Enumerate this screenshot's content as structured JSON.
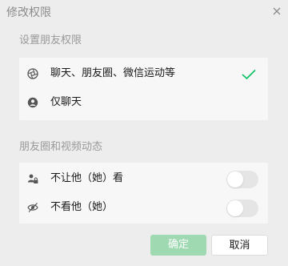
{
  "dialog": {
    "title": "修改权限",
    "close_icon": "close-icon"
  },
  "friend_permission": {
    "section_label": "设置朋友权限",
    "options": [
      {
        "label": "聊天、朋友圈、微信运动等",
        "icon": "settings-aperture-icon",
        "selected": true
      },
      {
        "label": "仅聊天",
        "icon": "user-circle-icon",
        "selected": false
      }
    ],
    "check_icon": "checkmark-icon"
  },
  "moments": {
    "section_label": "朋友圈和视频动态",
    "toggles": [
      {
        "label": "不让他（她）看",
        "icon": "lock-user-icon",
        "enabled": false
      },
      {
        "label": "不看他（她）",
        "icon": "eye-slash-icon",
        "enabled": false
      }
    ]
  },
  "footer": {
    "confirm_label": "确定",
    "cancel_label": "取消"
  },
  "colors": {
    "accent": "#07c160",
    "confirm_disabled_bg": "#9ed9b1",
    "background": "#ededed",
    "card": "#f7f7f7"
  }
}
